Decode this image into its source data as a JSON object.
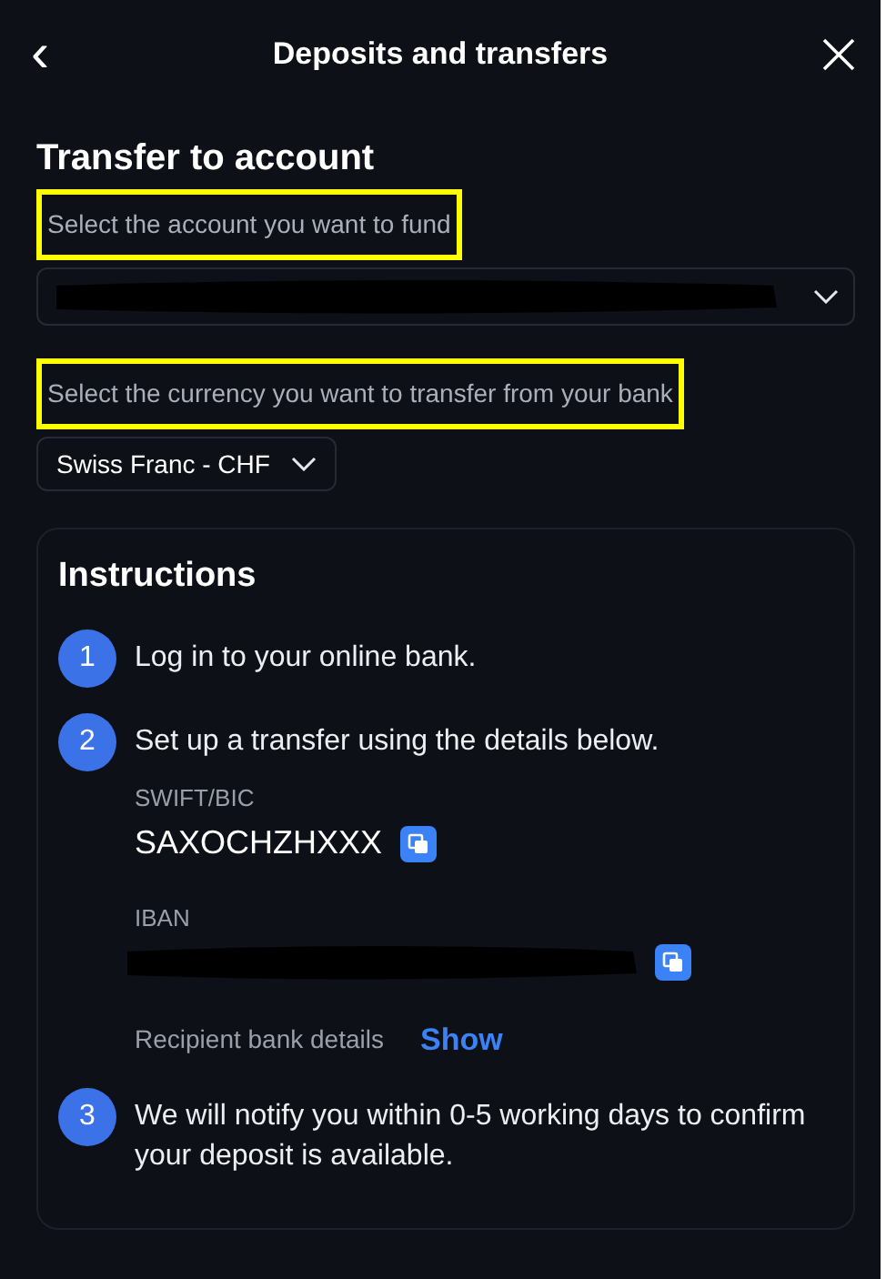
{
  "header": {
    "back": "‹",
    "title": "Deposits and transfers"
  },
  "section_title": "Transfer to account",
  "account": {
    "label": "Select the account you want to fund",
    "highlighted": true,
    "redacted": true
  },
  "currency": {
    "label": "Select the currency you want to transfer from your bank",
    "highlighted": true,
    "value": "Swiss Franc - CHF"
  },
  "instructions": {
    "title": "Instructions",
    "steps": [
      {
        "number": "1",
        "text": "Log in to your online bank."
      },
      {
        "number": "2",
        "text": "Set up a transfer using the details below.",
        "details": {
          "swift_label": "SWIFT/BIC",
          "swift_value": "SAXOCHZHXXX",
          "iban_label": "IBAN",
          "iban_redacted": true,
          "recipient_label": "Recipient bank details",
          "recipient_link": "Show"
        }
      },
      {
        "number": "3",
        "text": "We will notify you within 0-5 working days to confirm your deposit is available."
      }
    ]
  }
}
